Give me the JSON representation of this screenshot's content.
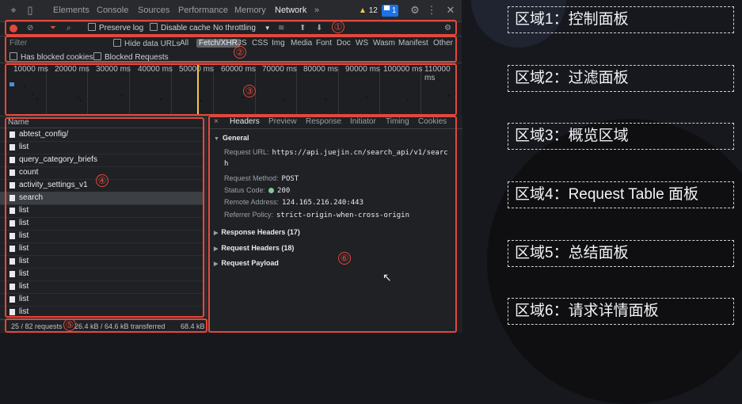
{
  "tabs": [
    "Elements",
    "Console",
    "Sources",
    "Performance",
    "Memory",
    "Network"
  ],
  "more": "»",
  "warnings": "12",
  "messages": "1",
  "toolbar": {
    "preserve_log": "Preserve log",
    "disable_cache": "Disable cache",
    "throttling": "No throttling"
  },
  "filter": {
    "placeholder": "Filter",
    "hide_data_urls": "Hide data URLs",
    "types": [
      "All",
      "Fetch/XHR",
      "JS",
      "CSS",
      "Img",
      "Media",
      "Font",
      "Doc",
      "WS",
      "Wasm",
      "Manifest",
      "Other"
    ],
    "selected_type": "Fetch/XHR",
    "blocked_cookies": "Has blocked cookies",
    "blocked_requests": "Blocked Requests"
  },
  "overview": {
    "ticks": [
      "10000 ms",
      "20000 ms",
      "30000 ms",
      "40000 ms",
      "50000 ms",
      "60000 ms",
      "70000 ms",
      "80000 ms",
      "90000 ms",
      "100000 ms",
      "110000 ms"
    ]
  },
  "requests": {
    "header": "Name",
    "rows": [
      "abtest_config/",
      "list",
      "query_category_briefs",
      "count",
      "activity_settings_v1",
      "search",
      "list",
      "list",
      "list",
      "list",
      "list",
      "list",
      "list",
      "list",
      "list"
    ],
    "selected": "search"
  },
  "summary": {
    "requests": "25 / 82 requests",
    "transferred": "26.4 kB / 64.6 kB transferred",
    "resources": "68.4 kB"
  },
  "details": {
    "tabs": [
      "Headers",
      "Preview",
      "Response",
      "Initiator",
      "Timing",
      "Cookies"
    ],
    "close": "×",
    "general": "General",
    "url_key": "Request URL:",
    "url_val_1": "https://api.juejin.cn/search_api/v1/searc",
    "url_val_2": "h",
    "method_key": "Request Method:",
    "method_val": "POST",
    "status_key": "Status Code:",
    "status_val": "200",
    "remote_key": "Remote Address:",
    "remote_val": "124.165.216.240:443",
    "referrer_key": "Referrer Policy:",
    "referrer_val": "strict-origin-when-cross-origin",
    "response_headers": "Response Headers (17)",
    "request_headers": "Request Headers (18)",
    "request_payload": "Request Payload"
  },
  "region_numbers": [
    "①",
    "②",
    "③",
    "④",
    "⑤",
    "⑥"
  ],
  "labels": [
    "区域1：控制面板",
    "区域2：过滤面板",
    "区域3：概览区域",
    "区域4：Request Table 面板",
    "区域5：总结面板",
    "区域6：请求详情面板"
  ],
  "colors": {
    "annotation": "#e2483d",
    "tab_accent": "#8ab4f8",
    "status_ok": "#81c995"
  }
}
